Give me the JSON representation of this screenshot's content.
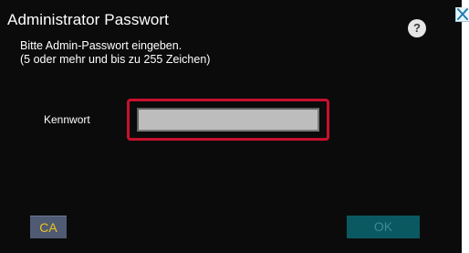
{
  "dialog": {
    "title": "Administrator Passwort",
    "help_icon": "?",
    "close_icon": "close-icon",
    "description": "Bitte Admin-Passwort eingeben.\n(5 oder mehr und bis zu 255 Zeichen)"
  },
  "password": {
    "label": "Kennwort",
    "value": ""
  },
  "buttons": {
    "ca_label": "CA",
    "ok_label": "OK"
  },
  "colors": {
    "background": "#0b0b0b",
    "highlight_frame": "#c8102e",
    "input_fill": "#bdbdbd",
    "ca_button": "#4f5b73",
    "ca_text": "#f0c21d",
    "ok_button_disabled": "#0a5961",
    "ok_text_disabled": "#3a8c94"
  }
}
